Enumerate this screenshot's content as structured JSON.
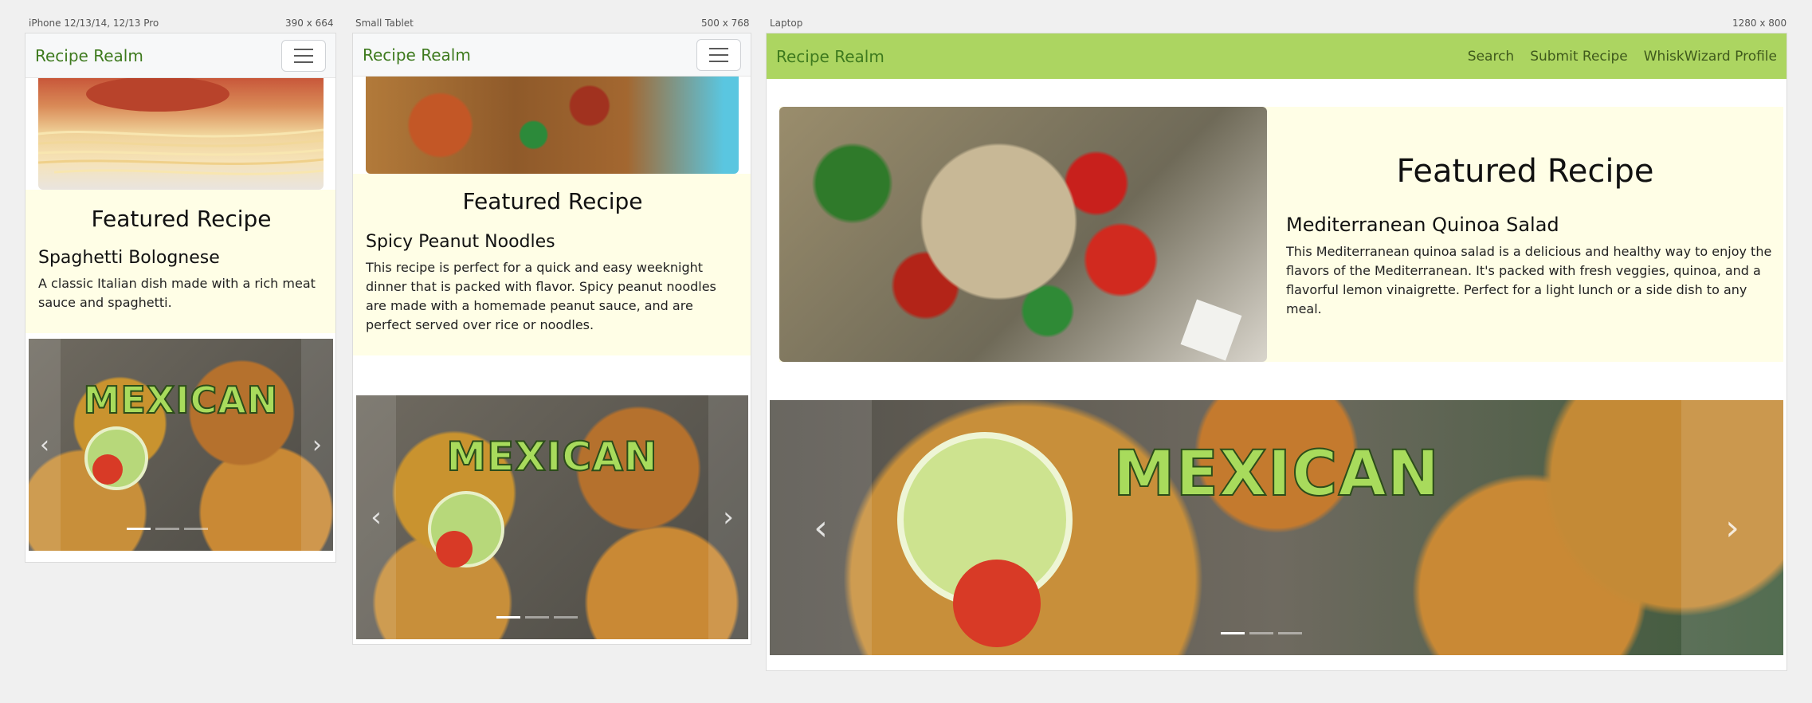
{
  "devices": [
    {
      "name": "iPhone 12/13/14, 12/13 Pro",
      "size": "390 x 664"
    },
    {
      "name": "Small Tablet",
      "size": "500 x 768"
    },
    {
      "name": "Laptop",
      "size": "1280 x 800"
    }
  ],
  "brand": "Recipe Realm",
  "nav": {
    "search": "Search",
    "submit": "Submit Recipe",
    "profile": "WhiskWizard Profile"
  },
  "feature_title": "Featured Recipe",
  "recipes": {
    "phone": {
      "name": "Spaghetti Bolognese",
      "desc": "A classic Italian dish made with a rich meat sauce and spaghetti."
    },
    "tablet": {
      "name": "Spicy Peanut Noodles",
      "desc": "This recipe is perfect for a quick and easy weeknight dinner that is packed with flavor. Spicy peanut noodles are made with a homemade peanut sauce, and are perfect served over rice or noodles."
    },
    "laptop": {
      "name": "Mediterranean Quinoa Salad",
      "desc": "This Mediterranean quinoa salad is a delicious and healthy way to enjoy the flavors of the Mediterranean. It's packed with fresh veggies, quinoa, and a flavorful lemon vinaigrette. Perfect for a light lunch or a side dish to any meal."
    }
  },
  "carousel": {
    "banner": "MEXICAN",
    "prev": "‹",
    "next": "›",
    "active_slide": 1,
    "slide_count": 3
  },
  "icons": {
    "menu": "hamburger-icon",
    "prev": "chevron-left-icon",
    "next": "chevron-right-icon"
  },
  "colors": {
    "brand": "#3e7a1e",
    "laptop_nav": "#acd561",
    "feature_bg": "#fffee6",
    "banner": "#a8db5c"
  }
}
